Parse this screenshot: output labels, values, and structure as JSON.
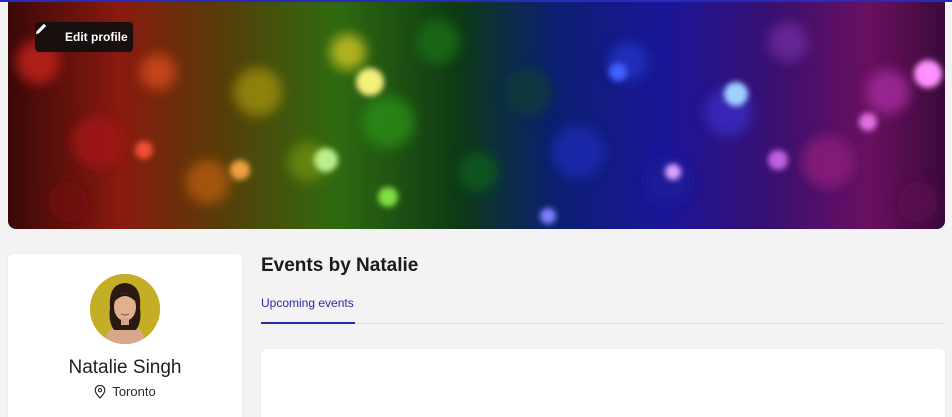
{
  "cover": {
    "edit_label": "Edit profile",
    "icon": "pencil-icon"
  },
  "profile": {
    "name": "Natalie Singh",
    "location": "Toronto",
    "location_icon": "map-pin-icon"
  },
  "events": {
    "title": "Events by Natalie",
    "tabs": [
      {
        "label": "Upcoming events",
        "active": true
      }
    ]
  },
  "colors": {
    "accent": "#2a2aa8",
    "background": "#f3f3f3"
  }
}
